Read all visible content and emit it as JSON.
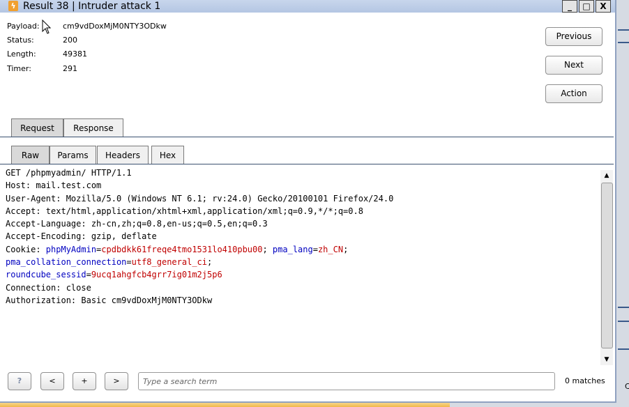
{
  "window": {
    "title": "Result 38 | Intruder attack 1",
    "controls": {
      "minimize": "_",
      "maximize": "□",
      "close": "X"
    }
  },
  "meta": {
    "payload": {
      "label": "Payload:",
      "value": "cm9vdDoxMjM0NTY3ODkw"
    },
    "status": {
      "label": "Status:",
      "value": "200"
    },
    "length": {
      "label": "Length:",
      "value": "49381"
    },
    "timer": {
      "label": "Timer:",
      "value": "291"
    }
  },
  "side_buttons": {
    "previous": "Previous",
    "next": "Next",
    "action": "Action"
  },
  "tabs": {
    "request": "Request",
    "response": "Response"
  },
  "subtabs": {
    "raw": "Raw",
    "params": "Params",
    "headers": "Headers",
    "hex": "Hex"
  },
  "request": {
    "line1": "GET /phpmyadmin/ HTTP/1.1",
    "line2": "Host: mail.test.com",
    "line3": "User-Agent: Mozilla/5.0 (Windows NT 6.1; rv:24.0) Gecko/20100101 Firefox/24.0",
    "line4": "Accept: text/html,application/xhtml+xml,application/xml;q=0.9,*/*;q=0.8",
    "line5": "Accept-Language: zh-cn,zh;q=0.8,en-us;q=0.5,en;q=0.3",
    "line6": "Accept-Encoding: gzip, deflate",
    "cookie": {
      "prefix": "Cookie: ",
      "c1_name": "phpMyAdmin",
      "c1_value": "cpdbdkk61freqe4tmo1531lo410pbu00",
      "c2_name": "pma_lang",
      "c2_value": "zh_CN",
      "c3_name": "pma_collation_connection",
      "c3_value": "utf8_general_ci",
      "c4_name": "roundcube_sessid",
      "c4_value": "9ucq1ahgfcb4grr7ig01m2j5p6"
    },
    "line_connection": "Connection: close",
    "line_auth": "Authorization: Basic cm9vdDoxMjM0NTY3ODkw"
  },
  "search": {
    "help": "?",
    "prev": "<",
    "add": "+",
    "next": ">",
    "placeholder": "Type a search term",
    "matches": "0 matches"
  },
  "background": {
    "fragment": "C"
  },
  "colors": {
    "title_bar": "#b4c6e3",
    "param_name": "#0000c0",
    "param_value": "#c00000",
    "taskbar": "#f0b84a"
  }
}
